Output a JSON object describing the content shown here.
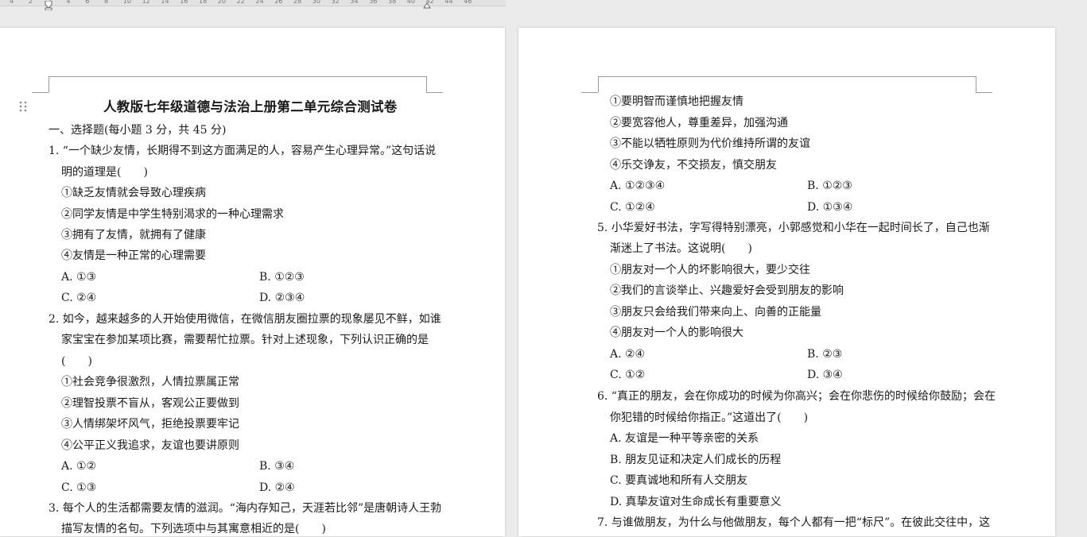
{
  "ruler": {
    "ticks": [
      "4",
      "2",
      "2",
      "4",
      "6",
      "8",
      "10",
      "12",
      "14",
      "16",
      "18",
      "20",
      "22",
      "24",
      "26",
      "28",
      "30",
      "32",
      "34",
      "36",
      "38",
      "40",
      "42",
      "44",
      "46"
    ]
  },
  "left_page": {
    "title": "人教版七年级道德与法治上册第二单元综合测试卷",
    "section": "一、选择题(每小题 3 分，共 45 分)",
    "q1_line1": "1. “一个缺少友情，长期得不到这方面满足的人，容易产生心理异常。”这句话说",
    "q1_line2": "明的道理是(　　)",
    "q1_s1": "①缺乏友情就会导致心理疾病",
    "q1_s2": "②同学友情是中学生特别渴求的一种心理需求",
    "q1_s3": "③拥有了友情，就拥有了健康",
    "q1_s4": "④友情是一种正常的心理需要",
    "q1_A": "A. ①③",
    "q1_B": "B. ①②③",
    "q1_C": "C. ②④",
    "q1_D": "D. ②③④",
    "q2_line1": "2. 如今，越来越多的人开始使用微信，在微信朋友圈拉票的现象屡见不鲜，如谁",
    "q2_line2": "家宝宝在参加某项比赛，需要帮忙拉票。针对上述现象，下列认识正确的是",
    "q2_line3": "(　　)",
    "q2_s1": "①社会竞争很激烈，人情拉票属正常",
    "q2_s2": "②理智投票不盲从，客观公正要做到",
    "q2_s3": "③人情绑架坏风气，拒绝投票要牢记",
    "q2_s4": "④公平正义我追求，友谊也要讲原则",
    "q2_A": "A. ①②",
    "q2_B": "B. ③④",
    "q2_C": "C. ①③",
    "q2_D": "D. ②④",
    "q3_line1": "3. 每个人的生活都需要友情的滋润。“海内存知己，天涯若比邻”是唐朝诗人王勃",
    "q3_line2": "描写友情的名句。下列选项中与其寓意相近的是(　　)"
  },
  "right_page": {
    "q4_s1": "①要明智而谨慎地把握友情",
    "q4_s2": "②要宽容他人，尊重差异，加强沟通",
    "q4_s3": "③不能以牺牲原则为代价维持所谓的友谊",
    "q4_s4": "④乐交诤友，不交损友，慎交朋友",
    "q4_A": "A. ①②③④",
    "q4_B": "B. ①②③",
    "q4_C": "C. ①②④",
    "q4_D": "D. ①③④",
    "q5_line1": "5. 小华爱好书法，字写得特别漂亮，小郭感觉和小华在一起时间长了，自己也渐",
    "q5_line2": "渐迷上了书法。这说明(　　)",
    "q5_s1": "①朋友对一个人的坏影响很大，要少交往",
    "q5_s2": "②我们的言谈举止、兴趣爱好会受到朋友的影响",
    "q5_s3": "③朋友只会给我们带来向上、向善的正能量",
    "q5_s4": "④朋友对一个人的影响很大",
    "q5_A": "A. ②④",
    "q5_B": "B. ②③",
    "q5_C": "C. ①②",
    "q5_D": "D. ③④",
    "q6_line1": "6. “真正的朋友，会在你成功的时候为你高兴；会在你悲伤的时候给你鼓励；会在",
    "q6_line2": "你犯错的时候给你指正。”这道出了(　　)",
    "q6_A": "A. 友谊是一种平等亲密的关系",
    "q6_B": "B. 朋友见证和决定人们成长的历程",
    "q6_C": "C. 要真诚地和所有人交朋友",
    "q6_D": "D. 真挚友谊对生命成长有重要意义",
    "q7_line1": "7. 与谁做朋友，为什么与他做朋友，每个人都有一把“标尺”。在彼此交往中，这"
  }
}
